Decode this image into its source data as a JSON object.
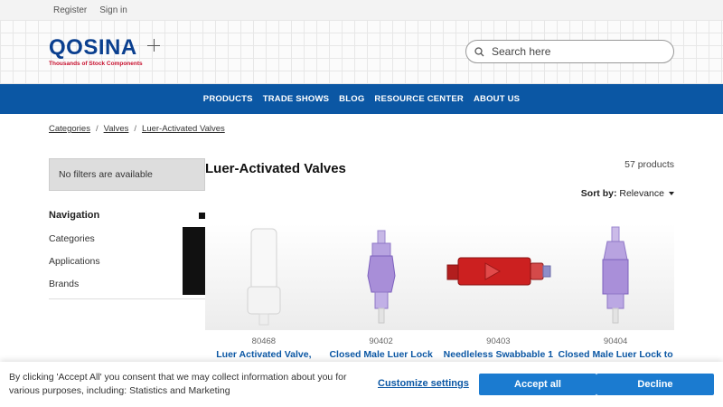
{
  "topbar": {
    "register": "Register",
    "signin": "Sign in"
  },
  "header": {
    "logo_text": "QOSINA",
    "logo_sub": "Thousands of Stock Components",
    "search_placeholder": "Search here"
  },
  "nav": [
    "PRODUCTS",
    "TRADE SHOWS",
    "BLOG",
    "RESOURCE CENTER",
    "ABOUT US"
  ],
  "breadcrumb": [
    "Categories",
    "Valves",
    "Luer-Activated Valves"
  ],
  "sidebar": {
    "filters_text": "No filters are available",
    "nav_heading": "Navigation",
    "items": [
      "Categories",
      "Applications",
      "Brands"
    ]
  },
  "main": {
    "title": "Luer-Activated Valves",
    "count": "57 products",
    "sort_label": "Sort by:",
    "sort_value": "Relevance"
  },
  "products": [
    {
      "number": "80468",
      "name": "Luer Activated Valve,"
    },
    {
      "number": "90402",
      "name": "Closed Male Luer Lock"
    },
    {
      "number": "90403",
      "name": "Needleless Swabbable 1"
    },
    {
      "number": "90404",
      "name": "Closed Male Luer Lock to"
    }
  ],
  "cookie": {
    "text": "By clicking 'Accept All' you consent that we may collect information about you for various purposes, including: Statistics and Marketing",
    "customize": "Customize settings",
    "accept": "Accept all",
    "decline": "Decline"
  },
  "colors": {
    "brand_blue": "#0b57a4",
    "button_blue": "#1b7bd0",
    "logo_red": "#c8102e"
  }
}
